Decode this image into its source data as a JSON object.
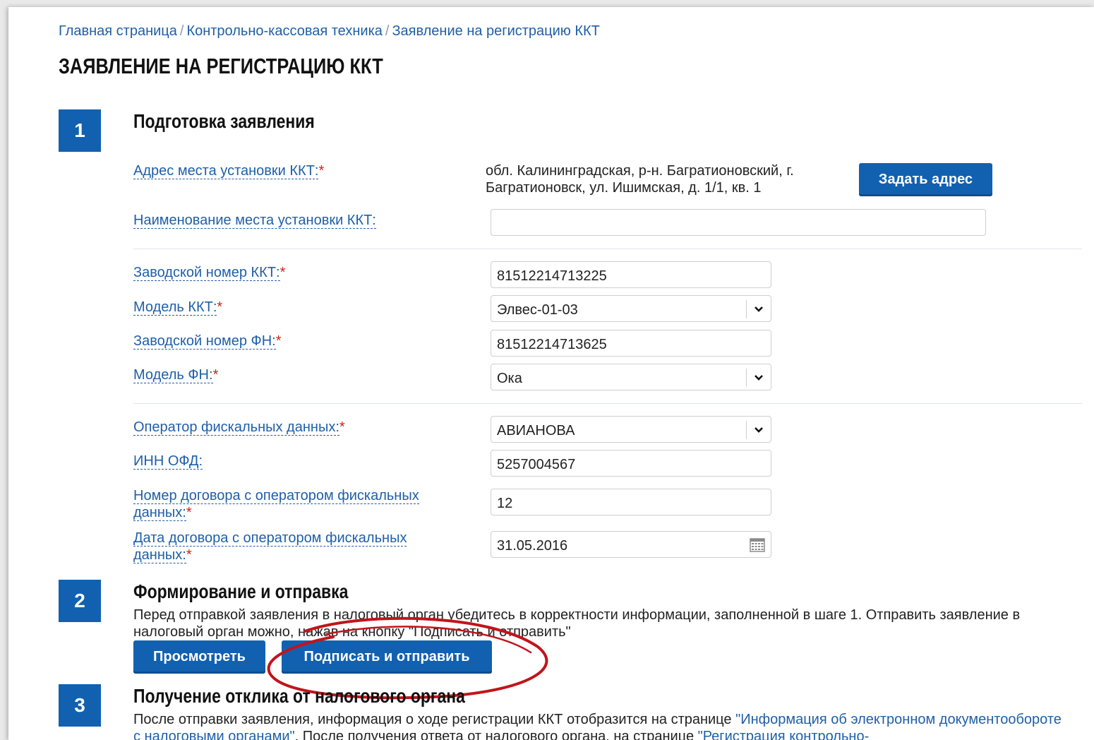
{
  "breadcrumb": {
    "items": [
      "Главная страница",
      "Контрольно-кассовая техника",
      "Заявление на регистрацию ККТ"
    ],
    "separator": "/"
  },
  "page_title": "ЗАЯВЛЕНИЕ НА РЕГИСТРАЦИЮ ККТ",
  "steps": [
    {
      "number": "1",
      "title": "Подготовка заявления"
    },
    {
      "number": "2",
      "title": "Формирование и отправка"
    },
    {
      "number": "3",
      "title": "Получение отклика от налогового органа"
    }
  ],
  "form": {
    "address_label": "Адрес места установки ККТ:",
    "address_value": "обл. Калининградская, р-н. Багратионовский, г. Багратионовск, ул. Ишимская, д. 1/1, кв. 1",
    "set_address_button": "Задать адрес",
    "place_name_label": "Наименование места установки ККТ:",
    "place_name_value": "",
    "kkt_serial_label": "Заводской номер ККТ:",
    "kkt_serial_value": "81512214713225",
    "kkt_model_label": "Модель ККТ:",
    "kkt_model_value": "Элвес-01-03",
    "fn_serial_label": "Заводской номер ФН:",
    "fn_serial_value": "81512214713625",
    "fn_model_label": "Модель ФН:",
    "fn_model_value": "Ока",
    "ofd_label": "Оператор фискальных данных:",
    "ofd_value": "АВИАНОВА",
    "ofd_inn_label": "ИНН ОФД:",
    "ofd_inn_value": "5257004567",
    "contract_number_label_1": "Номер договора с оператором фискальных",
    "contract_number_label_2": "данных:",
    "contract_number_value": "12",
    "contract_date_label_1": "Дата договора с оператором фискальных",
    "contract_date_label_2": "данных:",
    "contract_date_value": "31.05.2016",
    "required_mark": "*"
  },
  "step2": {
    "text_line1": "Перед отправкой заявления в налоговый орган убедитесь в корректности информации, заполненной в шаге 1. Отправить заявление в",
    "text_line2": "налоговый орган можно, нажав на кнопку \"Подписать и отправить\"",
    "preview_button": "Просмотреть",
    "sign_send_button": "Подписать и отправить"
  },
  "step3": {
    "text_start": "После отправки заявления, информация о ходе регистрации ККТ отобразится на странице ",
    "link1": "\"Информация об электронном документообороте с налоговыми органами\"",
    "text_mid": ". После получения ответа от налогового органа, на странице ",
    "link2": "\"Регистрация контрольно-"
  },
  "colors": {
    "accent": "#1261b1",
    "link": "#1f5fa8",
    "required": "#d4201c",
    "annotation": "#c0151b"
  },
  "icons": {
    "select_arrow": "chevron-down-icon",
    "calendar": "calendar-icon"
  }
}
